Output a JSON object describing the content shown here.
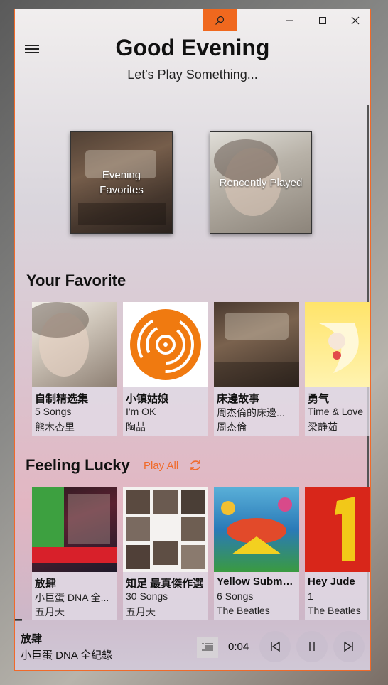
{
  "window": {
    "accent": "#f06a2a"
  },
  "header": {
    "title": "Good Evening",
    "subtitle": "Let's Play Something..."
  },
  "tiles": [
    {
      "label_line1": "Evening",
      "label_line2": "Favorites",
      "image": "bedtime-stories-album-art"
    },
    {
      "label": "Rencently Played",
      "image": "girl-portrait-art"
    }
  ],
  "favorites": {
    "title": "Your Favorite",
    "items": [
      {
        "title": "自制精选集",
        "line2": "5 Songs",
        "line3": "熊木杏里",
        "art": "portrait-art"
      },
      {
        "title": "小镇姑娘",
        "line2": "I'm OK",
        "line3": "陶喆",
        "art": "orange-disc-icon"
      },
      {
        "title": "床邊故事",
        "line2": "周杰倫的床邊...",
        "line3": "周杰倫",
        "art": "bedtime-stories-art"
      },
      {
        "title": "勇气",
        "line2": "Time & Love",
        "line3": "梁静茹",
        "art": "yellow-moon-art"
      }
    ]
  },
  "lucky": {
    "title": "Feeling Lucky",
    "play_all": "Play All",
    "items": [
      {
        "title": "放肆",
        "line2": "小巨蛋 DNA 全...",
        "line3": "五月天",
        "art": "mayday-art"
      },
      {
        "title": "知足 最真傑作選",
        "line2": "30 Songs",
        "line3": "五月天",
        "art": "photo-grid-art"
      },
      {
        "title": "Yellow Submarine",
        "line2": "6 Songs",
        "line3": "The Beatles",
        "art": "yellow-submarine-art"
      },
      {
        "title": "Hey Jude",
        "line2": "1",
        "line3": "The Beatles",
        "art": "beatles-one-art"
      }
    ]
  },
  "player": {
    "title": "放肆",
    "subtitle": "小巨蛋 DNA 全紀錄",
    "time": "0:04"
  }
}
